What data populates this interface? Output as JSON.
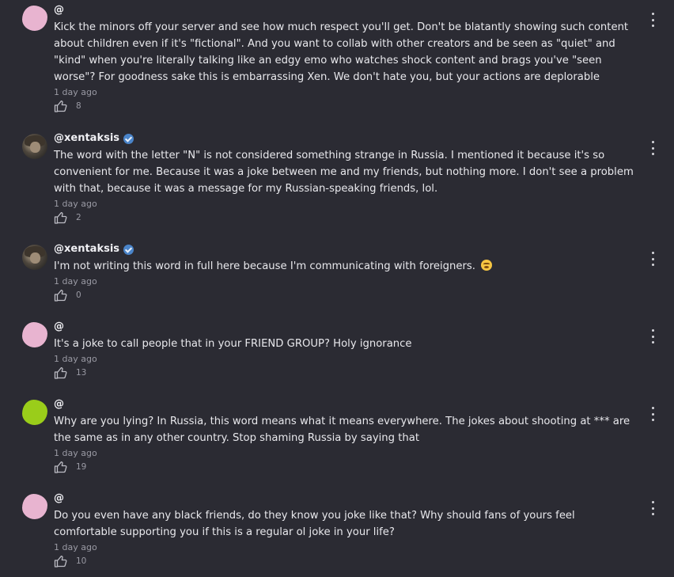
{
  "comments": [
    {
      "author": "@",
      "verified": false,
      "avatar_color": "#e8b4d0",
      "avatar_type": "blob",
      "text": "Kick the minors off your server and see how much respect you'll get. Don't be blatantly showing such content about children even if it's \"fictional\". And you want to collab with other creators and be seen as \"quiet\" and \"kind\" when you're literally talking like an edgy emo who watches shock content and brags you've \"seen worse\"? For goodness sake this is embarrassing Xen. We don't hate you, but your actions are deplorable",
      "time": "1 day ago",
      "likes": "8"
    },
    {
      "author": "@xentaksis",
      "verified": true,
      "avatar_type": "photo",
      "text": "The word with the letter \"N\" is not considered something strange in Russia. I mentioned it because it's so convenient for me. Because it was a joke between me and my friends, but nothing more. I don't see a problem with that, because it was a message for my Russian-speaking friends, lol.",
      "time": "1 day ago",
      "likes": "2"
    },
    {
      "author": "@xentaksis",
      "verified": true,
      "avatar_type": "photo",
      "text": "I'm not writing this word in full here because I'm communicating with foreigners.",
      "emoji": "😵",
      "time": "1 day ago",
      "likes": "0"
    },
    {
      "author": "@",
      "verified": false,
      "avatar_color": "#e8b4d0",
      "avatar_type": "blob",
      "text": "It's a joke to call people that in your FRIEND GROUP? Holy ignorance",
      "time": "1 day ago",
      "likes": "13"
    },
    {
      "author": "@",
      "verified": false,
      "avatar_color": "#9acd1a",
      "avatar_type": "blob",
      "text": "Why are you lying? In Russia, this word means what it means everywhere. The jokes about shooting at *** are the same as in any other country. Stop shaming Russia by saying that",
      "time": "1 day ago",
      "likes": "19"
    },
    {
      "author": "@",
      "verified": false,
      "avatar_color": "#e8b4d0",
      "avatar_type": "blob",
      "text": "Do you even have any black friends, do they know you joke like that? Why should fans of yours feel comfortable supporting you if this is a regular ol joke in your life?",
      "time": "1 day ago",
      "likes": "10"
    }
  ],
  "icons": {
    "like": "thumbs-up-icon",
    "menu": "more-vert-icon",
    "verified": "verified-badge-icon"
  },
  "colors": {
    "background": "#2b2b33",
    "text": "#e8e8ec",
    "muted": "#9a9aa4",
    "verified": "#4a84c9"
  }
}
